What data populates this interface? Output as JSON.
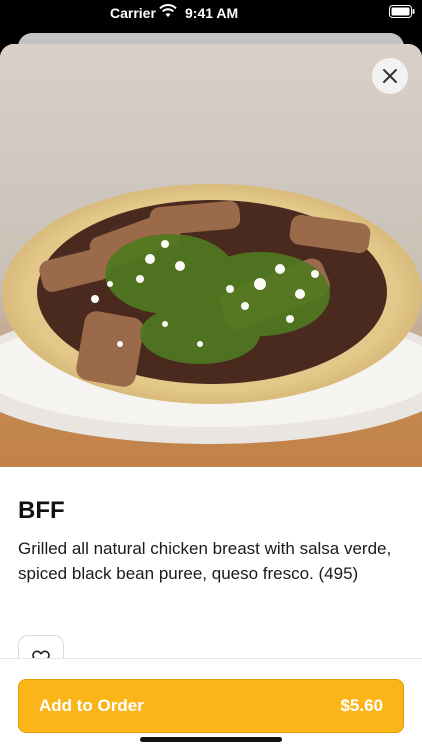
{
  "status_bar": {
    "carrier": "Carrier",
    "time": "9:41 AM",
    "wifi_icon": "wifi-icon",
    "battery_icon": "battery-full-icon"
  },
  "item": {
    "image_icon": "taco-photo",
    "title": "BFF",
    "description": "Grilled all natural chicken breast with salsa verde, spiced black bean puree, queso fresco. (495)"
  },
  "actions": {
    "close_icon": "close-icon",
    "favorite_icon": "heart-outline-icon",
    "add_to_order_label": "Add to Order",
    "price": "$5.60"
  },
  "colors": {
    "accent": "#fbb519",
    "accent_border": "#e89b00",
    "text": "#111111"
  }
}
